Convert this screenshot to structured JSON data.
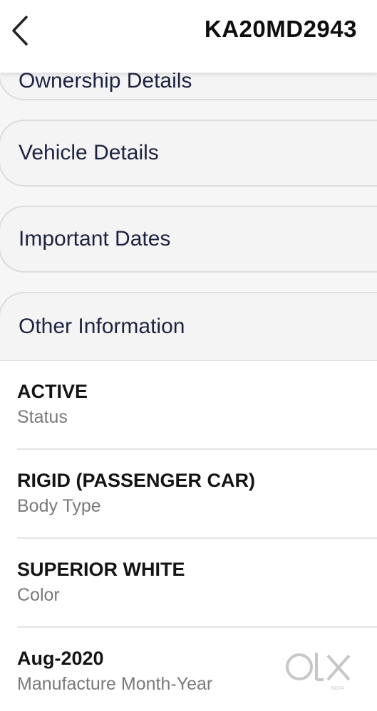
{
  "header": {
    "title": "KA20MD2943"
  },
  "sections": [
    {
      "label": "Ownership Details"
    },
    {
      "label": "Vehicle Details"
    },
    {
      "label": "Important Dates"
    },
    {
      "label": "Other Information"
    }
  ],
  "details": [
    {
      "value": "ACTIVE",
      "caption": "Status"
    },
    {
      "value": "RIGID (PASSENGER CAR)",
      "caption": "Body Type"
    },
    {
      "value": "SUPERIOR WHITE",
      "caption": "Color"
    },
    {
      "value": "Aug-2020",
      "caption": "Manufacture Month-Year"
    }
  ],
  "watermark": {
    "brand": "OLX",
    "sub": "INDIA"
  },
  "colors": {
    "section_text": "#1d2340",
    "caption_text": "#7a7a7a",
    "value_text": "#141414"
  }
}
